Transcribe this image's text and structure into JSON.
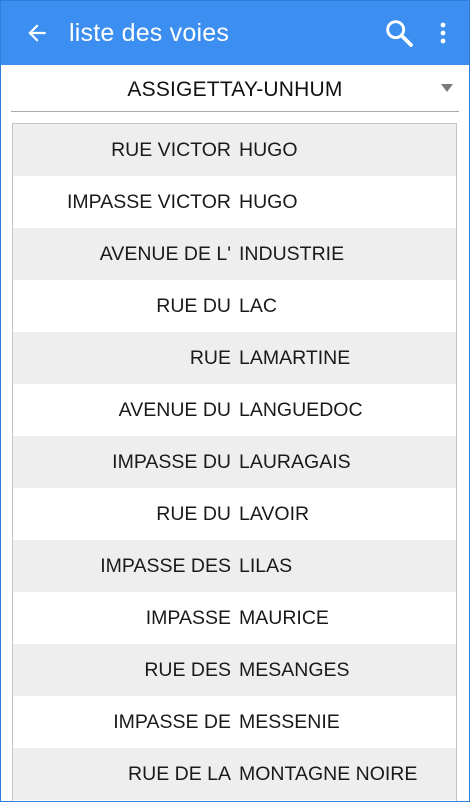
{
  "appbar": {
    "title": "liste des voies",
    "back_icon": "arrow-left-icon",
    "search_icon": "search-icon",
    "more_icon": "more-vertical-icon",
    "color": "#3c8ff0"
  },
  "commune_select": {
    "selected": "ASSIGETTAY-UNHUM"
  },
  "streets": [
    {
      "type": "RUE VICTOR",
      "name": "HUGO"
    },
    {
      "type": "IMPASSE VICTOR",
      "name": "HUGO"
    },
    {
      "type": "AVENUE DE L'",
      "name": "INDUSTRIE"
    },
    {
      "type": "RUE DU",
      "name": "LAC"
    },
    {
      "type": "RUE",
      "name": "LAMARTINE"
    },
    {
      "type": "AVENUE DU",
      "name": "LANGUEDOC"
    },
    {
      "type": "IMPASSE DU",
      "name": "LAURAGAIS"
    },
    {
      "type": "RUE DU",
      "name": "LAVOIR"
    },
    {
      "type": "IMPASSE DES",
      "name": "LILAS"
    },
    {
      "type": "IMPASSE",
      "name": "MAURICE"
    },
    {
      "type": "RUE DES",
      "name": "MESANGES"
    },
    {
      "type": "IMPASSE DE",
      "name": "MESSENIE"
    },
    {
      "type": "RUE DE LA",
      "name": "MONTAGNE NOIRE"
    }
  ]
}
